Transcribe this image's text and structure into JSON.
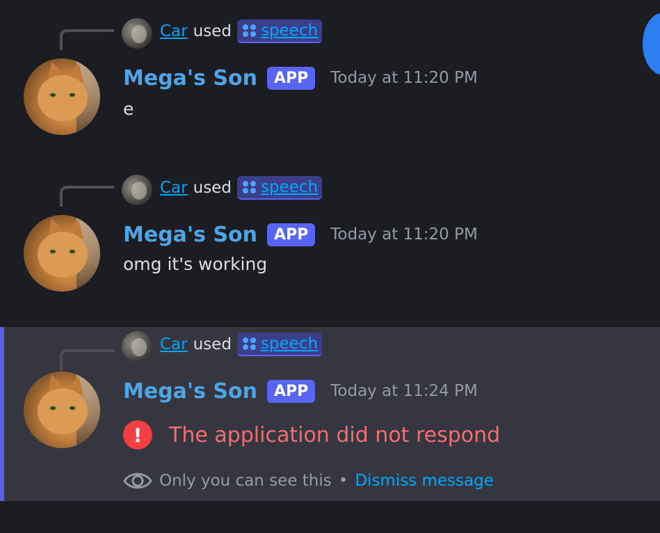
{
  "messages": [
    {
      "reply": {
        "user": "Car",
        "used": "used",
        "command": "speech"
      },
      "author": "Mega's Son",
      "badge": "APP",
      "time": "Today at 11:20 PM",
      "content": "e"
    },
    {
      "reply": {
        "user": "Car",
        "used": "used",
        "command": "speech"
      },
      "author": "Mega's Son",
      "badge": "APP",
      "time": "Today at 11:20 PM",
      "content": "omg it's working"
    },
    {
      "reply": {
        "user": "Car",
        "used": "used",
        "command": "speech"
      },
      "author": "Mega's Son",
      "badge": "APP",
      "time": "Today at 11:24 PM",
      "error": "The application did not respond",
      "ephemeral_note": "Only you can see this",
      "separator": "•",
      "dismiss": "Dismiss message"
    }
  ],
  "colors": {
    "background": "#1c1d22",
    "ephemeral_bg": "#35363f",
    "accent": "#5865f2",
    "link": "#00a8fc",
    "name": "#4ea5e6",
    "error": "#f26d70"
  }
}
